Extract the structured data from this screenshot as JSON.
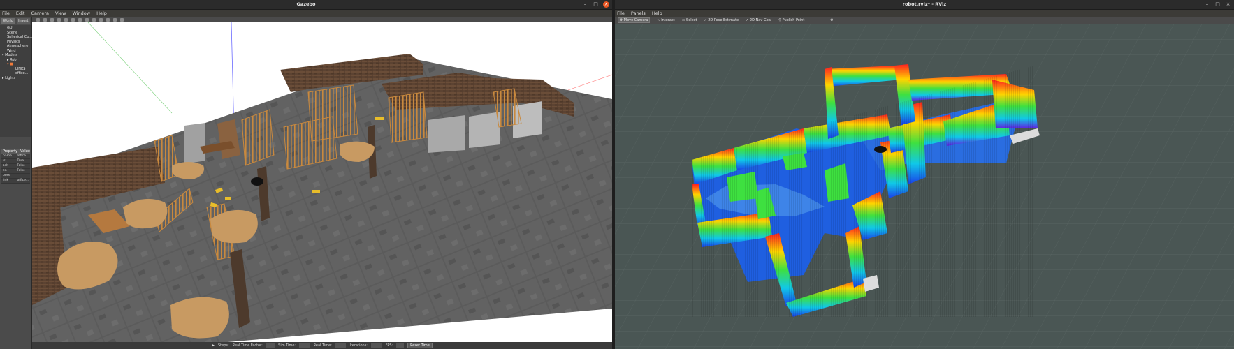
{
  "gazebo": {
    "title": "Gazebo",
    "menu": [
      "File",
      "Edit",
      "Camera",
      "View",
      "Window",
      "Help"
    ],
    "world_tabs": [
      "World",
      "Insert"
    ],
    "tree": [
      {
        "label": "GUI",
        "level": 1
      },
      {
        "label": "Scene",
        "level": 1
      },
      {
        "label": "Spherical Co...",
        "level": 1
      },
      {
        "label": "Physics",
        "level": 1
      },
      {
        "label": "Atmosphere",
        "level": 1
      },
      {
        "label": "Wind",
        "level": 1
      },
      {
        "label": "Models",
        "level": 0
      },
      {
        "label": "Rob",
        "level": 1
      },
      {
        "label": "LINKS",
        "level": 2
      },
      {
        "label": "office...",
        "level": 2
      },
      {
        "label": "Lights",
        "level": 0
      }
    ],
    "props_header": [
      "Property",
      "Value"
    ],
    "props_rows": [
      [
        "name",
        "office..."
      ],
      [
        "is",
        "True"
      ],
      [
        "self",
        "False"
      ],
      [
        "en",
        "False"
      ],
      [
        "pose",
        ""
      ],
      [
        "link",
        "office..."
      ]
    ],
    "status": {
      "steps_label": "Steps:",
      "factor_label": "Real Time Factor:",
      "sim_label": "Sim Time:",
      "real_label": "Real Time:",
      "iter_label": "Iterations:",
      "fps_label": "FPS:",
      "reset_label": "Reset Time"
    }
  },
  "rviz": {
    "title": "robot.rviz* - RViz",
    "menu": [
      "File",
      "Panels",
      "Help"
    ],
    "tools": [
      "Move Camera",
      "Interact",
      "Select",
      "2D Pose Estimate",
      "2D Nav Goal",
      "Publish Point"
    ]
  },
  "colors": {
    "ubuntu_orange": "#e95420",
    "floor_tile": "#5b5b5b",
    "wall_brick": "#5c4332",
    "fence": "#c9893e",
    "sand": "#c89a62",
    "rviz_bg": "#4a5654"
  }
}
